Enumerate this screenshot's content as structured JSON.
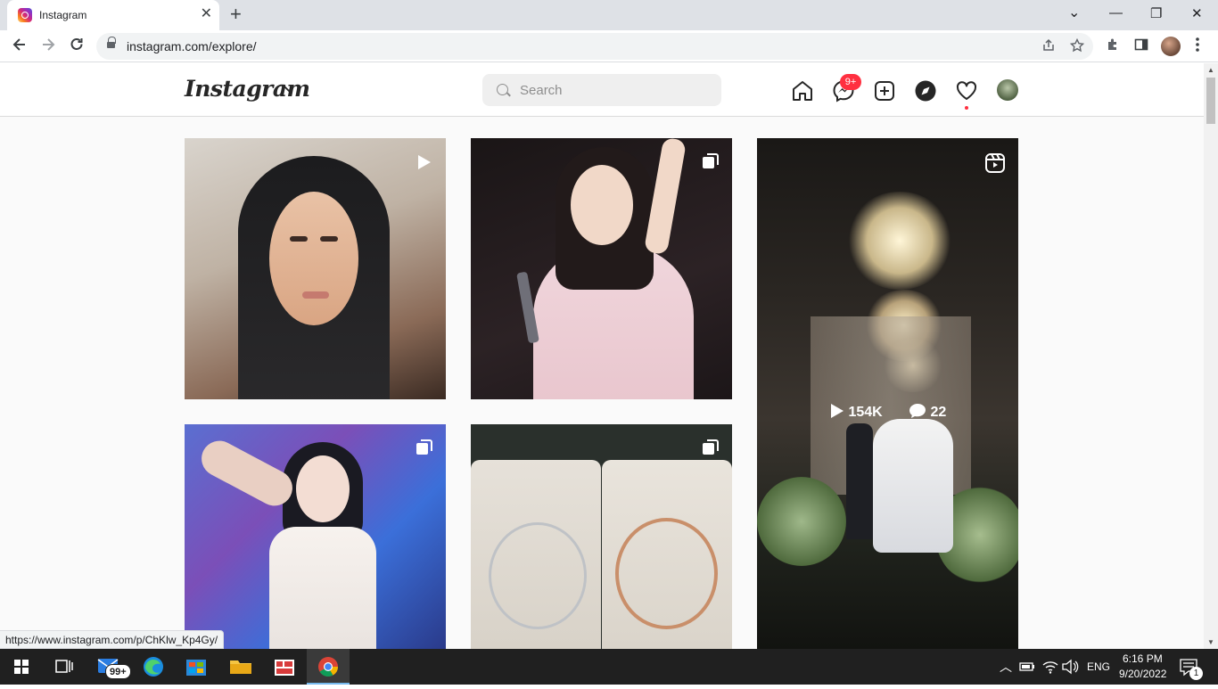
{
  "browser": {
    "tab_title": "Instagram",
    "close_tab": "✕",
    "new_tab": "+",
    "url": "instagram.com/explore/",
    "status_url": "https://www.instagram.com/p/ChKlw_Kp4Gy/"
  },
  "window_controls": {
    "menu": "⌄",
    "minimize": "—",
    "restore": "❐",
    "close": "✕"
  },
  "instagram": {
    "logo": "Instagram",
    "search_placeholder": "Search",
    "messages_badge": "9+"
  },
  "posts": [
    {
      "type": "reel"
    },
    {
      "type": "carousel"
    },
    {
      "type": "reel",
      "views": "154K",
      "comments": "22"
    },
    {
      "type": "carousel"
    },
    {
      "type": "carousel"
    }
  ],
  "taskbar": {
    "mail_badge": "99+",
    "language": "ENG",
    "time": "6:16 PM",
    "date": "9/20/2022",
    "notifications_badge": "1"
  }
}
